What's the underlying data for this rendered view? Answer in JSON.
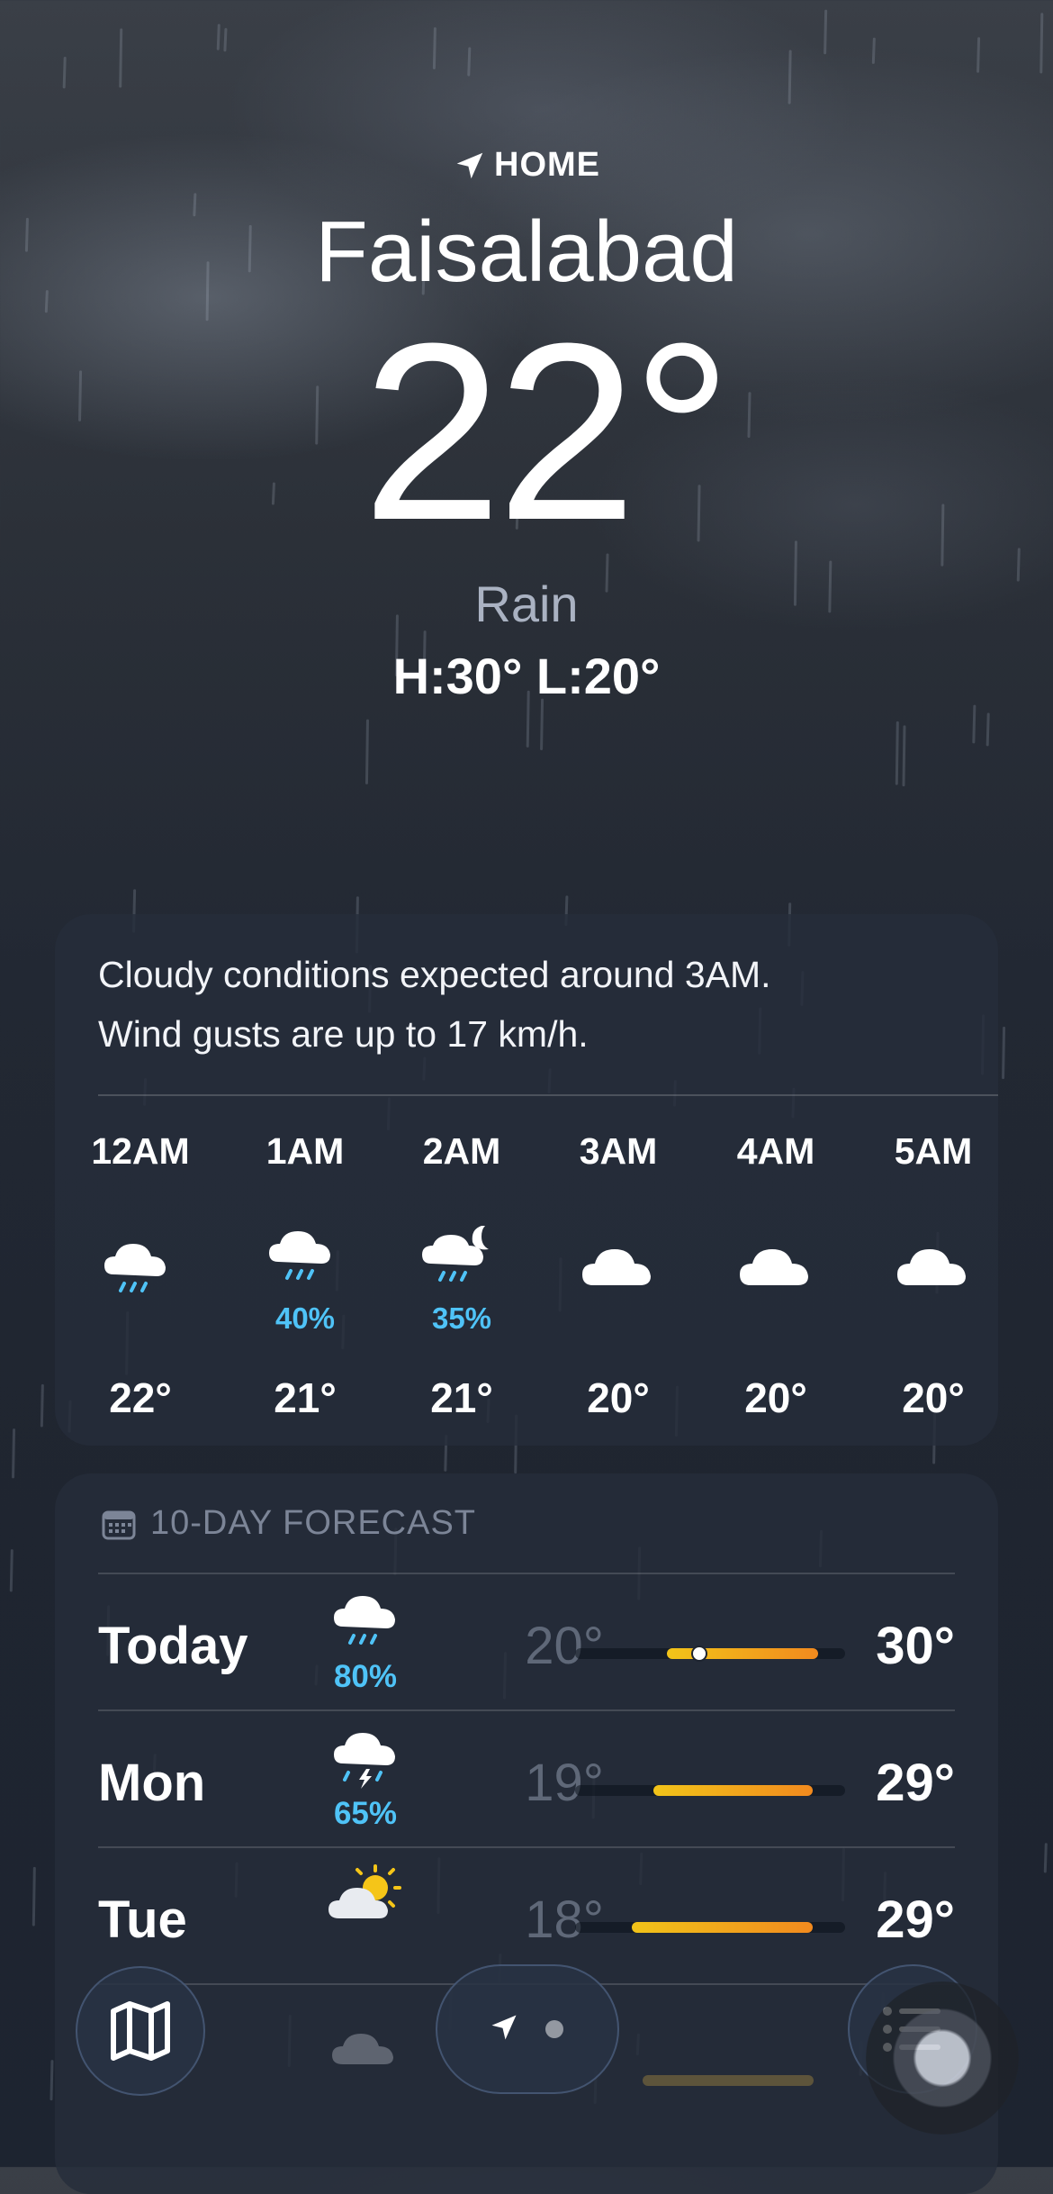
{
  "location": {
    "label": "HOME",
    "city": "Faisalabad"
  },
  "current": {
    "temp": "22°",
    "condition": "Rain",
    "hilo": "H:30°  L:20°"
  },
  "hourly_card": {
    "summary_line1": "Cloudy conditions expected around 3AM.",
    "summary_line2": "Wind gusts are up to 17 km/h.",
    "hours": [
      {
        "time": "12AM",
        "icon": "rain-cloud-icon",
        "precip": "",
        "temp": "22°"
      },
      {
        "time": "1AM",
        "icon": "rain-cloud-icon",
        "precip": "40%",
        "temp": "21°"
      },
      {
        "time": "2AM",
        "icon": "moon-rain-cloud-icon",
        "precip": "35%",
        "temp": "21°"
      },
      {
        "time": "3AM",
        "icon": "cloud-icon",
        "precip": "",
        "temp": "20°"
      },
      {
        "time": "4AM",
        "icon": "cloud-icon",
        "precip": "",
        "temp": "20°"
      },
      {
        "time": "5AM",
        "icon": "cloud-icon",
        "precip": "",
        "temp": "20°"
      }
    ]
  },
  "forecast_card": {
    "title": "10-DAY FORECAST",
    "days": [
      {
        "name": "Today",
        "icon": "rain-cloud-icon",
        "precip": "80%",
        "low": "20°",
        "high": "30°",
        "range_start": 0.34,
        "range_end": 0.9,
        "current_pos": 0.46
      },
      {
        "name": "Mon",
        "icon": "thunderstorm-icon",
        "precip": "65%",
        "low": "19°",
        "high": "29°",
        "range_start": 0.29,
        "range_end": 0.88
      },
      {
        "name": "Tue",
        "icon": "sun-cloud-icon",
        "precip": "",
        "low": "18°",
        "high": "29°",
        "range_start": 0.21,
        "range_end": 0.88
      }
    ]
  },
  "toolbar": {
    "map": "map-icon",
    "location": "location-arrow-icon",
    "list": "list-icon"
  },
  "colors": {
    "precip": "#4fc3f7",
    "range_gradient": [
      "#f2c419",
      "#f28a1e"
    ]
  }
}
